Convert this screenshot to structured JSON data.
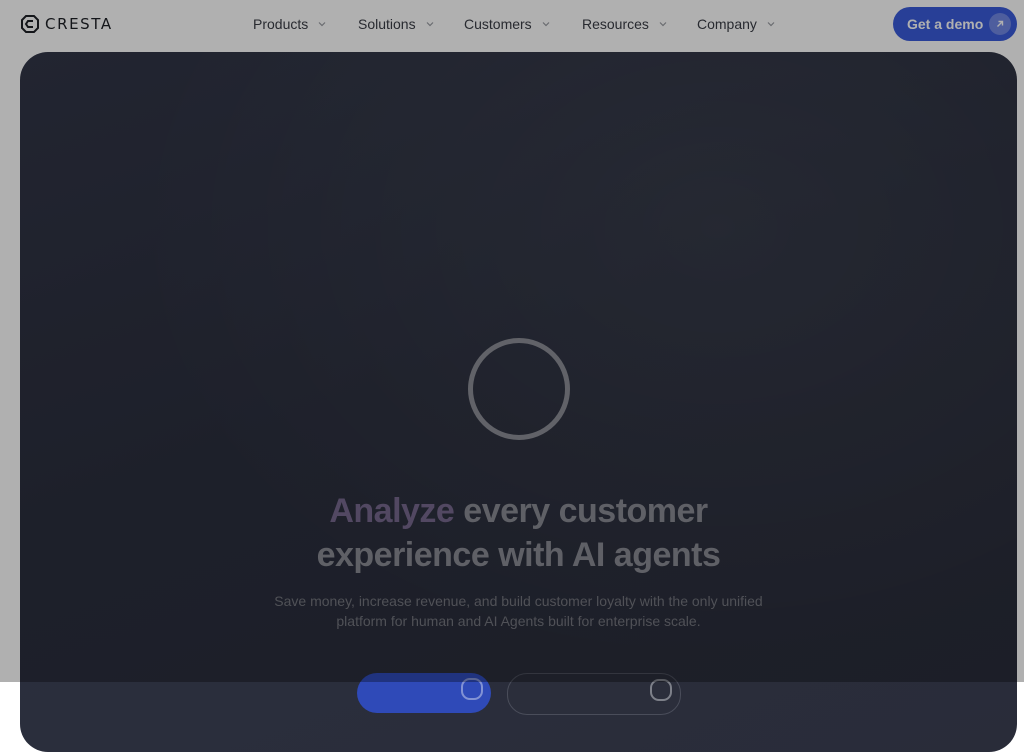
{
  "header": {
    "logo_text": "CRESTA",
    "nav": [
      {
        "label": "Products"
      },
      {
        "label": "Solutions"
      },
      {
        "label": "Customers"
      },
      {
        "label": "Resources"
      },
      {
        "label": "Company"
      }
    ],
    "cta_label": "Get a demo"
  },
  "hero": {
    "headline_accent": "Analyze",
    "headline_rest": " every customer",
    "headline_line2": "experience with AI agents",
    "subtitle_line1": "Save money, increase revenue, and build customer loyalty with the only unified",
    "subtitle_line2": "platform for human and AI Agents built for enterprise scale."
  },
  "colors": {
    "brand_blue": "#3b5cdb",
    "hero_bg": "#2b2f3e",
    "accent_purple": "#78698f"
  }
}
